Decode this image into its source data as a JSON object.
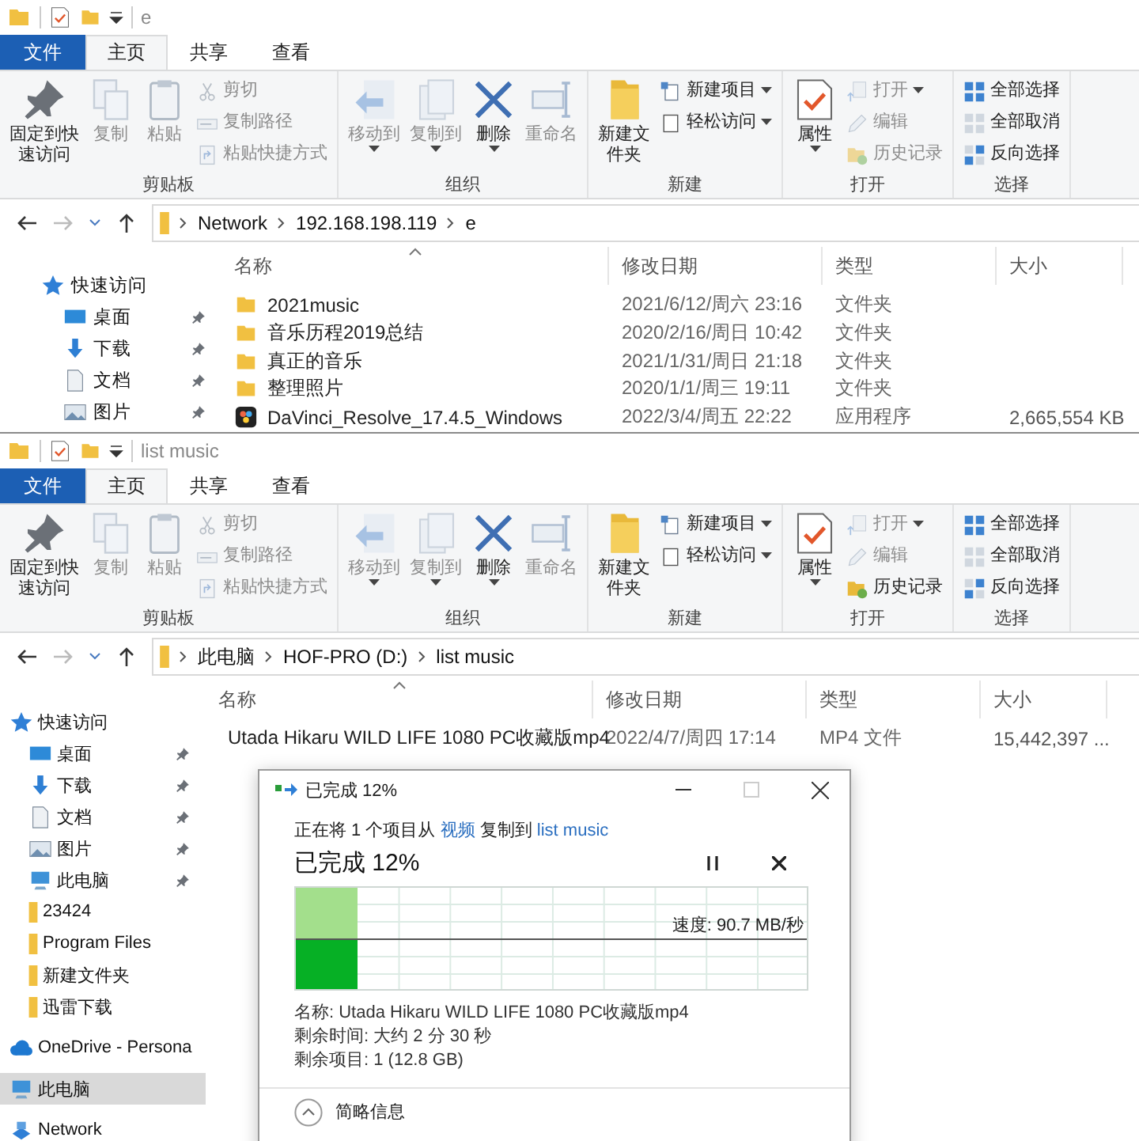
{
  "explorers": [
    {
      "title": "e",
      "tabs": [
        {
          "label": "文件",
          "kind": "file",
          "selected": false
        },
        {
          "label": "主页",
          "kind": "tab",
          "selected": true
        },
        {
          "label": "共享",
          "kind": "tab",
          "selected": false
        },
        {
          "label": "查看",
          "kind": "tab",
          "selected": false
        }
      ],
      "ribbon": [
        {
          "label": "剪贴板",
          "items": [
            {
              "label": "固定到快速访问",
              "kind": "pin",
              "large": true,
              "disabled": false,
              "dropdown": false
            },
            {
              "label": "复制",
              "kind": "copy",
              "large": true,
              "disabled": true,
              "dropdown": false
            },
            {
              "label": "粘贴",
              "kind": "paste",
              "large": true,
              "disabled": true,
              "dropdown": false
            },
            {
              "label": "剪切",
              "kind": "cut",
              "large": false,
              "disabled": true,
              "dropdown": false
            },
            {
              "label": "复制路径",
              "kind": "copy-path",
              "large": false,
              "disabled": true,
              "dropdown": false
            },
            {
              "label": "粘贴快捷方式",
              "kind": "paste-shortcut",
              "large": false,
              "disabled": true,
              "dropdown": false
            }
          ]
        },
        {
          "label": "组织",
          "items": [
            {
              "label": "移动到",
              "kind": "move-to",
              "large": true,
              "disabled": true,
              "dropdown": true
            },
            {
              "label": "复制到",
              "kind": "copy-to",
              "large": true,
              "disabled": true,
              "dropdown": true
            },
            {
              "label": "删除",
              "kind": "delete",
              "large": true,
              "disabled": false,
              "dropdown": true
            },
            {
              "label": "重命名",
              "kind": "rename",
              "large": true,
              "disabled": true,
              "dropdown": false
            }
          ]
        },
        {
          "label": "新建",
          "items": [
            {
              "label": "新建文件夹",
              "kind": "new-folder",
              "large": true,
              "disabled": false,
              "dropdown": false
            },
            {
              "label": "新建项目",
              "kind": "new-item",
              "large": false,
              "disabled": false,
              "dropdown": true
            },
            {
              "label": "轻松访问",
              "kind": "easy-access",
              "large": false,
              "disabled": false,
              "dropdown": true
            }
          ]
        },
        {
          "label": "打开",
          "items": [
            {
              "label": "属性",
              "kind": "properties",
              "large": true,
              "disabled": false,
              "dropdown": true
            },
            {
              "label": "打开",
              "kind": "open",
              "large": false,
              "disabled": true,
              "dropdown": true
            },
            {
              "label": "编辑",
              "kind": "edit",
              "large": false,
              "disabled": true,
              "dropdown": false
            },
            {
              "label": "历史记录",
              "kind": "history",
              "large": false,
              "disabled": true,
              "dropdown": false
            }
          ]
        },
        {
          "label": "选择",
          "items": [
            {
              "label": "全部选择",
              "kind": "select-all",
              "large": false,
              "disabled": false,
              "dropdown": false
            },
            {
              "label": "全部取消",
              "kind": "select-none",
              "large": false,
              "disabled": false,
              "dropdown": false
            },
            {
              "label": "反向选择",
              "kind": "invert",
              "large": false,
              "disabled": false,
              "dropdown": false
            }
          ]
        }
      ],
      "address": {
        "crumbs": [
          "Network",
          "192.168.198.119",
          "e"
        ]
      },
      "sidebar": [
        {
          "label": "快速访问",
          "kind": "quick-access",
          "selected": false,
          "pinned": false,
          "children": [
            {
              "label": "桌面",
              "kind": "desktop",
              "selected": false,
              "pinned": true
            },
            {
              "label": "下载",
              "kind": "downloads",
              "selected": false,
              "pinned": true
            },
            {
              "label": "文档",
              "kind": "documents",
              "selected": false,
              "pinned": true
            },
            {
              "label": "图片",
              "kind": "pictures",
              "selected": false,
              "pinned": true
            }
          ]
        }
      ],
      "columns": [
        "名称",
        "修改日期",
        "类型",
        "大小"
      ],
      "rows": [
        {
          "name": "2021music",
          "kind": "folder",
          "date": "2021/6/12/周六 23:16",
          "type": "文件夹"
        },
        {
          "name": "音乐历程2019总结",
          "kind": "folder",
          "date": "2020/2/16/周日 10:42",
          "type": "文件夹"
        },
        {
          "name": "真正的音乐",
          "kind": "folder",
          "date": "2021/1/31/周日 21:18",
          "type": "文件夹"
        },
        {
          "name": "整理照片",
          "kind": "folder",
          "date": "2020/1/1/周三 19:11",
          "type": "文件夹"
        },
        {
          "name": "DaVinci_Resolve_17.4.5_Windows",
          "kind": "app",
          "date": "2022/3/4/周五 22:22",
          "type": "应用程序",
          "size": "2,665,554 KB"
        }
      ]
    },
    {
      "title": "list music",
      "tabs": [
        {
          "label": "文件",
          "kind": "file",
          "selected": false
        },
        {
          "label": "主页",
          "kind": "tab",
          "selected": true
        },
        {
          "label": "共享",
          "kind": "tab",
          "selected": false
        },
        {
          "label": "查看",
          "kind": "tab",
          "selected": false
        }
      ],
      "ribbon": [
        {
          "label": "剪贴板",
          "items": [
            {
              "label": "固定到快速访问",
              "kind": "pin",
              "large": true,
              "disabled": false,
              "dropdown": false
            },
            {
              "label": "复制",
              "kind": "copy",
              "large": true,
              "disabled": true,
              "dropdown": false
            },
            {
              "label": "粘贴",
              "kind": "paste",
              "large": true,
              "disabled": true,
              "dropdown": false
            },
            {
              "label": "剪切",
              "kind": "cut",
              "large": false,
              "disabled": true,
              "dropdown": false
            },
            {
              "label": "复制路径",
              "kind": "copy-path",
              "large": false,
              "disabled": true,
              "dropdown": false
            },
            {
              "label": "粘贴快捷方式",
              "kind": "paste-shortcut",
              "large": false,
              "disabled": true,
              "dropdown": false
            }
          ]
        },
        {
          "label": "组织",
          "items": [
            {
              "label": "移动到",
              "kind": "move-to",
              "large": true,
              "disabled": true,
              "dropdown": true
            },
            {
              "label": "复制到",
              "kind": "copy-to",
              "large": true,
              "disabled": true,
              "dropdown": true
            },
            {
              "label": "删除",
              "kind": "delete",
              "large": true,
              "disabled": false,
              "dropdown": true
            },
            {
              "label": "重命名",
              "kind": "rename",
              "large": true,
              "disabled": true,
              "dropdown": false
            }
          ]
        },
        {
          "label": "新建",
          "items": [
            {
              "label": "新建文件夹",
              "kind": "new-folder",
              "large": true,
              "disabled": false,
              "dropdown": false
            },
            {
              "label": "新建项目",
              "kind": "new-item",
              "large": false,
              "disabled": false,
              "dropdown": true
            },
            {
              "label": "轻松访问",
              "kind": "easy-access",
              "large": false,
              "disabled": false,
              "dropdown": true
            }
          ]
        },
        {
          "label": "打开",
          "items": [
            {
              "label": "属性",
              "kind": "properties",
              "large": true,
              "disabled": false,
              "dropdown": true
            },
            {
              "label": "打开",
              "kind": "open",
              "large": false,
              "disabled": true,
              "dropdown": true
            },
            {
              "label": "编辑",
              "kind": "edit",
              "large": false,
              "disabled": true,
              "dropdown": false
            },
            {
              "label": "历史记录",
              "kind": "history",
              "large": false,
              "disabled": false,
              "dropdown": false
            }
          ]
        },
        {
          "label": "选择",
          "items": [
            {
              "label": "全部选择",
              "kind": "select-all",
              "large": false,
              "disabled": false,
              "dropdown": false
            },
            {
              "label": "全部取消",
              "kind": "select-none",
              "large": false,
              "disabled": false,
              "dropdown": false
            },
            {
              "label": "反向选择",
              "kind": "invert",
              "large": false,
              "disabled": false,
              "dropdown": false
            }
          ]
        }
      ],
      "address": {
        "crumbs": [
          "此电脑",
          "HOF-PRO (D:)",
          "list music"
        ]
      },
      "sidebar": [
        {
          "label": "快速访问",
          "kind": "quick-access",
          "selected": false,
          "pinned": false,
          "children": [
            {
              "label": "桌面",
              "kind": "desktop",
              "selected": false,
              "pinned": true
            },
            {
              "label": "下载",
              "kind": "downloads",
              "selected": false,
              "pinned": true
            },
            {
              "label": "文档",
              "kind": "documents",
              "selected": false,
              "pinned": true
            },
            {
              "label": "图片",
              "kind": "pictures",
              "selected": false,
              "pinned": true
            },
            {
              "label": "此电脑",
              "kind": "pc",
              "selected": false,
              "pinned": true
            },
            {
              "label": "23424",
              "kind": "folder",
              "selected": false,
              "pinned": false
            },
            {
              "label": "Program Files",
              "kind": "folder",
              "selected": false,
              "pinned": false
            },
            {
              "label": "新建文件夹",
              "kind": "folder",
              "selected": false,
              "pinned": false
            },
            {
              "label": "迅雷下载",
              "kind": "folder",
              "selected": false,
              "pinned": false
            }
          ]
        },
        {
          "label": "OneDrive - Persona",
          "kind": "cloud",
          "selected": false,
          "pinned": false
        },
        {
          "label": "此电脑",
          "kind": "pc",
          "selected": true,
          "pinned": false
        },
        {
          "label": "Network",
          "kind": "network",
          "selected": false,
          "pinned": false
        }
      ],
      "columns": [
        "名称",
        "修改日期",
        "类型",
        "大小"
      ],
      "rows": [
        {
          "name": "Utada Hikaru WILD LIFE 1080 PC收藏版mp4",
          "kind": "video",
          "date": "2022/4/7/周四 17:14",
          "type": "MP4 文件",
          "size": "15,442,397 ..."
        }
      ]
    }
  ],
  "dialog": {
    "title": "已完成 12%",
    "description": [
      {
        "kind": "text",
        "text": "正在将 1 个项目从 "
      },
      {
        "kind": "link",
        "text": "视频"
      },
      {
        "kind": "text",
        "text": " 复制到 "
      },
      {
        "kind": "link",
        "text": "list music"
      }
    ],
    "heading": "已完成 12%",
    "progress": {
      "level": 0.12
    },
    "speed": "速度: 90.7 MB/秒",
    "details": [
      "名称: Utada Hikaru WILD LIFE 1080 PC收藏版mp4",
      "剩余时间: 大约 2 分 30 秒",
      "剩余项目: 1 (12.8 GB)"
    ],
    "toggle": "简略信息"
  }
}
